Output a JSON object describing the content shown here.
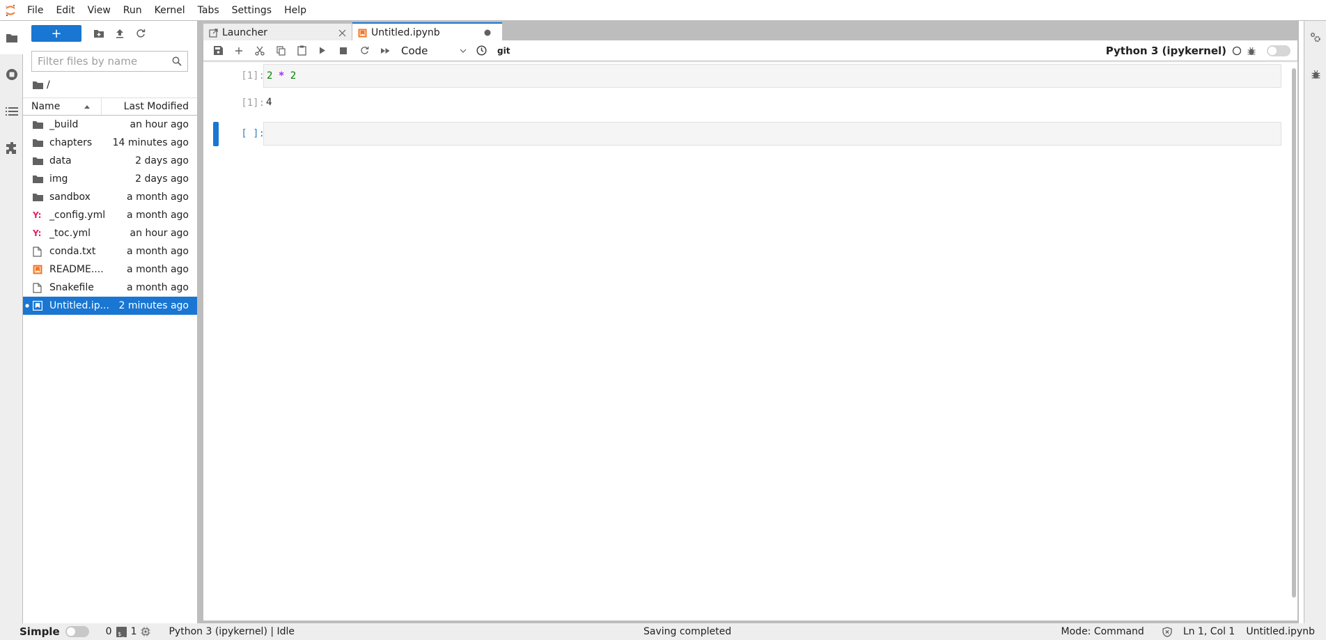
{
  "menubar": {
    "items": [
      "File",
      "Edit",
      "View",
      "Run",
      "Kernel",
      "Tabs",
      "Settings",
      "Help"
    ]
  },
  "left_sidebar": {
    "tabs": [
      {
        "name": "file-browser",
        "icon": "folder-icon",
        "active": true
      },
      {
        "name": "running",
        "icon": "stop-circle-icon",
        "active": false
      },
      {
        "name": "table-of-contents",
        "icon": "list-icon",
        "active": false
      },
      {
        "name": "extensions",
        "icon": "puzzle-icon",
        "active": false
      }
    ]
  },
  "filebrowser": {
    "new_button_label": "+",
    "filter_placeholder": "Filter files by name",
    "filter_value": "",
    "breadcrumb": "/",
    "columns": {
      "name": "Name",
      "modified": "Last Modified"
    },
    "files": [
      {
        "name": "_build",
        "type": "folder",
        "modified": "an hour ago"
      },
      {
        "name": "chapters",
        "type": "folder",
        "modified": "14 minutes ago"
      },
      {
        "name": "data",
        "type": "folder",
        "modified": "2 days ago"
      },
      {
        "name": "img",
        "type": "folder",
        "modified": "2 days ago"
      },
      {
        "name": "sandbox",
        "type": "folder",
        "modified": "a month ago"
      },
      {
        "name": "_config.yml",
        "type": "yaml",
        "modified": "a month ago"
      },
      {
        "name": "_toc.yml",
        "type": "yaml",
        "modified": "an hour ago"
      },
      {
        "name": "conda.txt",
        "type": "file",
        "modified": "a month ago"
      },
      {
        "name": "README....",
        "type": "notebook",
        "modified": "a month ago"
      },
      {
        "name": "Snakefile",
        "type": "file",
        "modified": "a month ago"
      },
      {
        "name": "Untitled.ip...",
        "type": "notebook",
        "modified": "2 minutes ago",
        "selected": true,
        "running": true
      }
    ]
  },
  "tabs": [
    {
      "label": "Launcher",
      "active": false
    },
    {
      "label": "Untitled.ipynb",
      "active": true,
      "dirty": true
    }
  ],
  "notebook_toolbar": {
    "cell_type": "Code",
    "git_label": "git",
    "kernel_name": "Python 3 (ipykernel)"
  },
  "cells": [
    {
      "prompt": "[1]:",
      "code": [
        "2",
        "*",
        "2"
      ],
      "output_prompt": "[1]:",
      "output": "4"
    },
    {
      "prompt": "[ ]:",
      "code": [],
      "active": true
    }
  ],
  "statusbar": {
    "simple_label": "Simple",
    "terminals_count": "0",
    "terminal_badge": "$_",
    "kernels_count": "1",
    "kernel_status": "Python 3 (ipykernel) | Idle",
    "message": "Saving completed",
    "mode": "Mode: Command",
    "cursor": "Ln 1, Col 1",
    "file": "Untitled.ipynb"
  },
  "colors": {
    "accent": "#1976d2",
    "yaml": "#e91e63",
    "notebook_orange": "#f37626",
    "code_number": "#008000",
    "code_operator": "#aa22ff"
  }
}
